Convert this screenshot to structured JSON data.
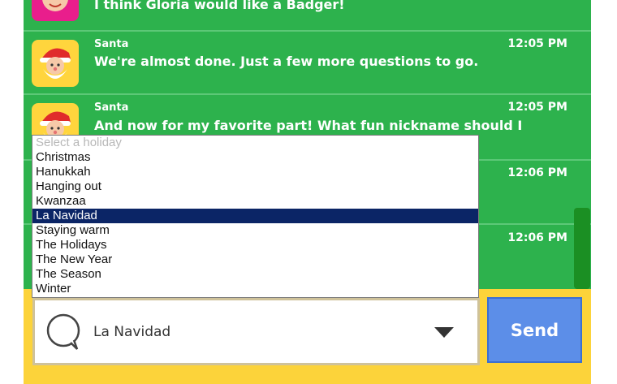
{
  "chat": {
    "messages": [
      {
        "sender": "",
        "text": "I think Gloria would like a Badger!",
        "time": "",
        "avatar": "elf"
      },
      {
        "sender": "Santa",
        "text": "We're almost done. Just a few more questions to go.",
        "time": "12:05 PM",
        "avatar": "santa"
      },
      {
        "sender": "Santa",
        "text": "And now for my favorite part! What fun nickname should I",
        "time": "12:05 PM",
        "avatar": "santa"
      },
      {
        "sender": "",
        "text": "",
        "time": "12:06 PM",
        "avatar": ""
      },
      {
        "sender": "",
        "text": "",
        "time": "12:06 PM",
        "avatar": ""
      }
    ]
  },
  "dropdown": {
    "placeholder": "Select a holiday",
    "options": [
      "Christmas",
      "Hanukkah",
      "Hanging out",
      "Kwanzaa",
      "La Navidad",
      "Staying warm",
      "The Holidays",
      "The New Year",
      "The Season",
      "Winter"
    ],
    "selected": "La Navidad"
  },
  "composer": {
    "value": "La Navidad",
    "send_label": "Send"
  },
  "colors": {
    "chat_bg": "#2db24d",
    "composer_bg": "#fcd33a",
    "send_button": "#5c8ee8",
    "selected_option": "#0b2566"
  }
}
